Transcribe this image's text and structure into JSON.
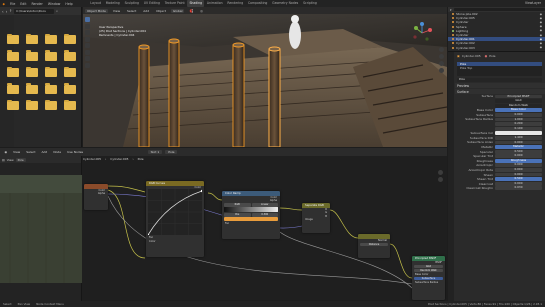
{
  "menu": [
    "File",
    "Edit",
    "Render",
    "Window",
    "Help"
  ],
  "workspace_tabs": [
    "Layout",
    "Modeling",
    "Sculpting",
    "UV Editing",
    "Texture Paint",
    "Shading",
    "Animation",
    "Rendering",
    "Compositing",
    "Geometry Nodes",
    "Scripting"
  ],
  "active_workspace": "Shading",
  "scene": "ViewLayer",
  "filebrowser": {
    "path": "C:\\Users\\Anton\\Docu",
    "items": [
      "",
      "",
      "",
      "",
      "",
      "",
      "",
      "",
      "",
      "",
      "",
      "",
      "",
      "",
      "",
      "",
      "",
      "",
      "",
      ""
    ],
    "labels": [
      "",
      "",
      "",
      "",
      "",
      "",
      "",
      "",
      "",
      "",
      "",
      "",
      "",
      "",
      "",
      "",
      "",
      "",
      "",
      ""
    ]
  },
  "viewport": {
    "mode": "Object Mode",
    "menus": [
      "View",
      "Select",
      "Add",
      "Object"
    ],
    "transform": "Global",
    "info": [
      "User Perspective",
      "(25) Post Sections | Cylinder.004",
      "Remnants | Cylinder.004"
    ]
  },
  "outliner": {
    "rows": [
      {
        "label": "Stone pile.002",
        "color": "#e39a3f",
        "selected": false
      },
      {
        "label": "Cylinder.005",
        "color": "#e39a3f",
        "selected": false
      },
      {
        "label": "Cylinder",
        "color": "#e39a3f",
        "selected": false
      },
      {
        "label": "Sphere",
        "color": "#e39a3f",
        "selected": false
      },
      {
        "label": "Lighting",
        "color": "#9ad16b",
        "selected": false
      },
      {
        "label": "Cylinder",
        "color": "#e39a3f",
        "selected": false
      },
      {
        "label": "Cylinder.001",
        "color": "#e39a3f",
        "selected": true
      },
      {
        "label": "Cylinder.002",
        "color": "#e39a3f",
        "selected": false
      },
      {
        "label": "Cylinder.003",
        "color": "#e39a3f",
        "selected": false
      }
    ]
  },
  "properties": {
    "object": "Cylinder.005",
    "material": "Pole",
    "slots": [
      "Pole",
      "Pole Top"
    ],
    "section_preview": "Preview",
    "section_surface": "Surface",
    "surface_shader": "Principled BSDF",
    "distribution": "GGX",
    "subsurface_method": "Random Walk",
    "rows": [
      {
        "label": "Base Color",
        "value": "Base Color",
        "type": "blue"
      },
      {
        "label": "Subsurface",
        "value": "0.000",
        "type": "field"
      },
      {
        "label": "Subsurface Radius",
        "value": "1.000",
        "type": "field"
      },
      {
        "label": "",
        "value": "0.200",
        "type": "field"
      },
      {
        "label": "",
        "value": "0.100",
        "type": "field"
      },
      {
        "label": "Subsurface Col",
        "value": "",
        "type": "swatch",
        "color": "#e8e8e8"
      },
      {
        "label": "Subsurface IOR",
        "value": "1.400",
        "type": "field"
      },
      {
        "label": "Subsurface Aniso",
        "value": "0.000",
        "type": "field"
      },
      {
        "label": "Metallic",
        "value": "Metallic",
        "type": "blue"
      },
      {
        "label": "Specular",
        "value": "0.500",
        "type": "field"
      },
      {
        "label": "Specular Tint",
        "value": "0.000",
        "type": "field"
      },
      {
        "label": "Roughness",
        "value": "Roughness",
        "type": "blue"
      },
      {
        "label": "Anisotropic",
        "value": "0.000",
        "type": "field"
      },
      {
        "label": "Anisotropic Rota",
        "value": "0.000",
        "type": "field"
      },
      {
        "label": "Sheen",
        "value": "0.000",
        "type": "field"
      },
      {
        "label": "Sheen Tint",
        "value": "0.500",
        "type": "blue"
      },
      {
        "label": "Clearcoat",
        "value": "0.000",
        "type": "field"
      },
      {
        "label": "Clearcoat Roughn",
        "value": "0.030",
        "type": "field"
      }
    ]
  },
  "node_editor": {
    "menus": [
      "View",
      "Select",
      "Add",
      "Node",
      "Use Nodes"
    ],
    "slot": "Slot 1",
    "material": "Pole",
    "breadcrumb": [
      "Cylinder.005",
      "Cylinder.005",
      "Pole"
    ],
    "nodes": {
      "img1": {
        "title": "",
        "rows": [
          "Color",
          "Alpha"
        ]
      },
      "curves": {
        "title": "RGB Curves",
        "rows": [
          "Color",
          "Fac",
          "Color"
        ]
      },
      "ramp": {
        "title": "Color Ramp",
        "rows": [
          "Color",
          "Alpha",
          "RGB",
          "Linear",
          "Pos",
          "0.300",
          "Fac"
        ]
      },
      "sep": {
        "title": "Separate RGB",
        "rows": [
          "R",
          "G",
          "B",
          "Image"
        ]
      },
      "mix": {
        "title": "",
        "rows": [
          "Color",
          "Roughness",
          "Factor",
          "Color",
          "Color"
        ]
      },
      "bump": {
        "title": "",
        "rows": [
          "Normal",
          "Distance"
        ]
      },
      "output": {
        "title": "Principled BSDF",
        "rows": [
          "BSDF",
          "GGX",
          "Random Walk",
          "Base Color",
          "Subsurface",
          "Subsurface Radius"
        ]
      }
    }
  },
  "status": {
    "left": "Select",
    "middle": "Pan View",
    "right": "Node Context Menu",
    "info": "Post Sections | Cylinder.005 | Verts:80 | Faces:91 | Tris:160 | Objects:1/26 | 2.93.1"
  }
}
